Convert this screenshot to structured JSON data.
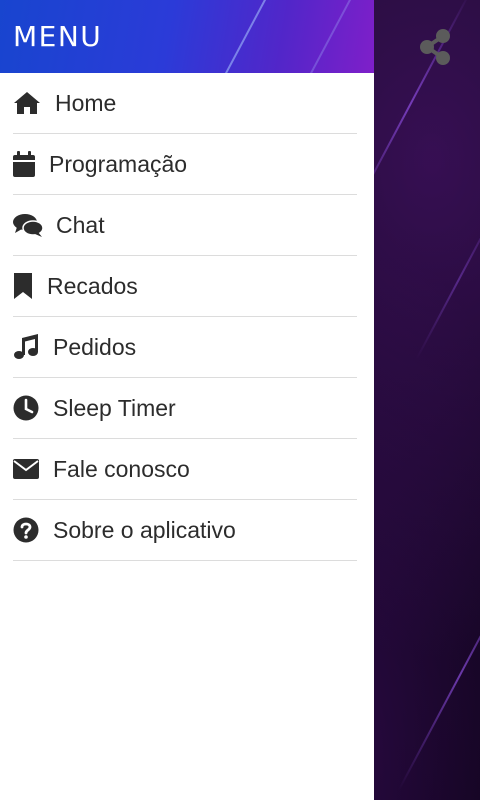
{
  "drawer": {
    "title": "MENU",
    "items": [
      {
        "label": "Home",
        "icon": "home-icon"
      },
      {
        "label": "Programação",
        "icon": "calendar-icon"
      },
      {
        "label": "Chat",
        "icon": "chat-icon"
      },
      {
        "label": "Recados",
        "icon": "bookmark-icon"
      },
      {
        "label": "Pedidos",
        "icon": "music-note-icon"
      },
      {
        "label": "Sleep Timer",
        "icon": "clock-icon"
      },
      {
        "label": "Fale conosco",
        "icon": "envelope-icon"
      },
      {
        "label": "Sobre o aplicativo",
        "icon": "question-circle-icon"
      }
    ]
  },
  "toolbar": {
    "share_icon": "share-icon"
  },
  "colors": {
    "header_start": "#1845cf",
    "header_end": "#7f1fc9",
    "drawer_bg": "#ffffff",
    "item_text": "#2c2c2c",
    "divider": "#dcdcdc",
    "share_icon": "#5b5b5b",
    "background": "#150722"
  }
}
